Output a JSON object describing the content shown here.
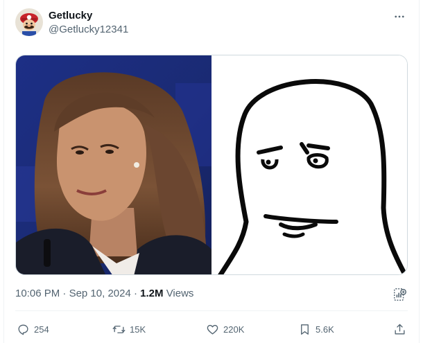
{
  "author": {
    "display_name": "Getlucky",
    "handle": "@Getlucky12341"
  },
  "header": {
    "more_icon": "more-horizontal-icon"
  },
  "media": {
    "left_image": "photo of a woman with shoulder-length brown hair in front of a blue background",
    "right_image": "hand-drawn meme face with raised eyebrows"
  },
  "meta": {
    "time": "10:06 PM",
    "separator": "·",
    "date": "Sep 10, 2024",
    "views_count": "1.2M",
    "views_label": "Views"
  },
  "actions": {
    "replies": "254",
    "reposts": "15K",
    "likes": "220K",
    "bookmarks": "5.6K"
  },
  "colors": {
    "text_primary": "#0f1419",
    "text_secondary": "#536471",
    "border": "#cfd9de",
    "divider": "#eff3f4"
  }
}
